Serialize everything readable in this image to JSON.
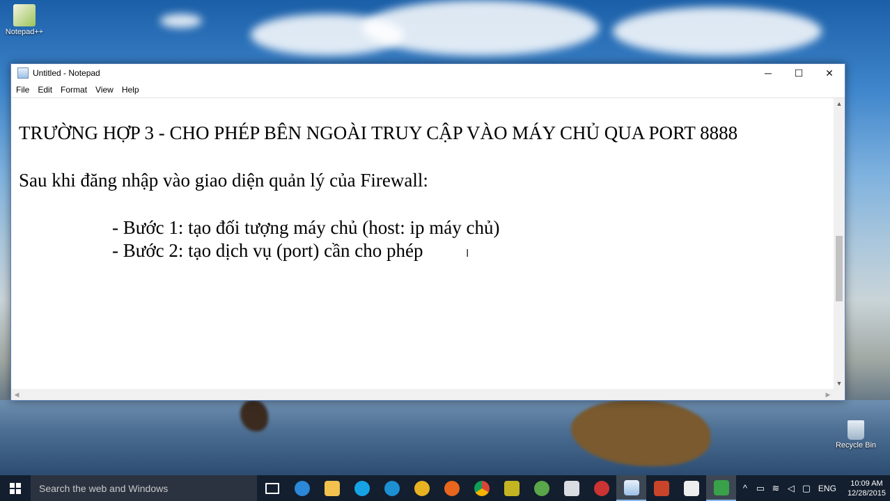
{
  "desktop": {
    "icons": [
      {
        "label": "Notepad++"
      },
      {
        "label": "Recycle Bin"
      }
    ]
  },
  "window": {
    "title": "Untitled - Notepad",
    "controls": {
      "minimize": "─",
      "maximize": "☐",
      "close": "✕"
    },
    "menu": [
      "File",
      "Edit",
      "Format",
      "View",
      "Help"
    ],
    "content": {
      "line1": "TRƯỜNG HỢP 3 - CHO PHÉP BÊN NGOÀI TRUY CẬP VÀO MÁY CHỦ QUA PORT 8888",
      "line2": "Sau khi đăng nhập vào giao diện quản lý của Firewall:",
      "line3": "- Bước 1: tạo đối tượng máy chủ (host: ip máy chủ)",
      "line4": "- Bước 2: tạo dịch vụ (port) cần cho phép"
    }
  },
  "taskbar": {
    "search_placeholder": "Search the web and Windows",
    "apps": [
      "task-view",
      "edge",
      "file-explorer",
      "skype",
      "skype-blue",
      "folder-app",
      "firefox",
      "chrome",
      "app-yellow",
      "maps-app",
      "font-app",
      "paint-app",
      "notepad",
      "powerpoint",
      "camtasia",
      "camtasia-recorder"
    ],
    "tray": {
      "language": "ENG",
      "time": "10:09 AM",
      "date": "12/28/2015"
    }
  }
}
